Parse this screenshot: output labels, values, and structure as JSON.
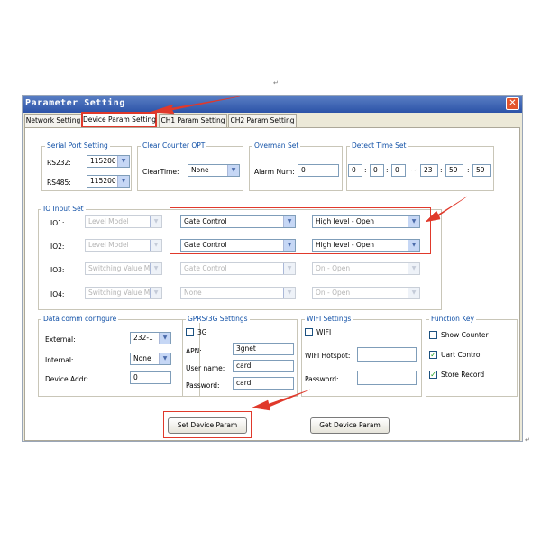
{
  "top_mark": "↵",
  "side_mark": "↵",
  "window": {
    "title": "Parameter Setting",
    "close": "✕"
  },
  "tabs": [
    "Network Setting",
    "Device Param Setting",
    "CH1 Param Setting",
    "CH2 Param Setting"
  ],
  "serial": {
    "legend": "Serial Port Setting",
    "rs232_label": "RS232:",
    "rs232_value": "115200",
    "rs485_label": "RS485:",
    "rs485_value": "115200"
  },
  "clear": {
    "legend": "Clear Counter OPT",
    "label": "ClearTime:",
    "value": "None"
  },
  "overman": {
    "legend": "Overman Set",
    "label": "Alarm Num:",
    "value": "0"
  },
  "detect": {
    "legend": "Detect Time Set",
    "start": [
      "0",
      "0",
      "0"
    ],
    "end": [
      "23",
      "59",
      "59"
    ],
    "colon": ":",
    "tilde": "~"
  },
  "io": {
    "legend": "IO Input Set",
    "rows": [
      {
        "label": "IO1:",
        "model": "Level Model",
        "func": "Gate Control",
        "level": "High level - Open"
      },
      {
        "label": "IO2:",
        "model": "Level Model",
        "func": "Gate Control",
        "level": "High level - Open"
      },
      {
        "label": "IO3:",
        "model": "Switching Value Mo",
        "func": "Gate Control",
        "level": "On - Open"
      },
      {
        "label": "IO4:",
        "model": "Switching Value Mo",
        "func": "None",
        "level": "On - Open"
      }
    ]
  },
  "datacomm": {
    "legend": "Data comm configure",
    "external_label": "External:",
    "external_value": "232-1",
    "internal_label": "Internal:",
    "internal_value": "None",
    "addr_label": "Device Addr:",
    "addr_value": "0"
  },
  "gprs": {
    "legend": "GPRS/3G Settings",
    "chk": "3G",
    "apn_label": "APN:",
    "apn_value": "3gnet",
    "user_label": "User name:",
    "user_value": "card",
    "pwd_label": "Password:",
    "pwd_value": "card"
  },
  "wifi": {
    "legend": "WIFI Settings",
    "chk": "WIFI",
    "hotspot_label": "WIFI Hotspot:",
    "pwd_label": "Password:"
  },
  "funckey": {
    "legend": "Function Key",
    "items": [
      {
        "label": "Show Counter",
        "checked": false
      },
      {
        "label": "Uart Control",
        "checked": true
      },
      {
        "label": "Store Record",
        "checked": true
      }
    ]
  },
  "buttons": {
    "set": "Set Device Param",
    "get": "Get Device Param"
  },
  "colors": {
    "annotation_red": "#e0392b",
    "title_blue": "#2c53a8",
    "legend_blue": "#0f4fa6"
  }
}
